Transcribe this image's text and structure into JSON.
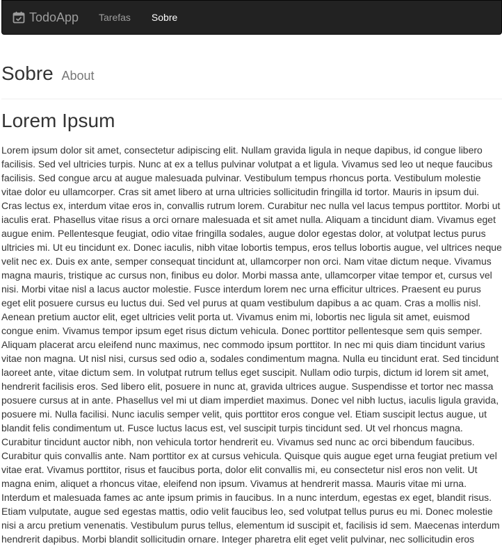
{
  "navbar": {
    "brand": "TodoApp",
    "brand_icon": "calendar-check-icon",
    "items": [
      {
        "label": "Tarefas",
        "active": false
      },
      {
        "label": "Sobre",
        "active": true
      }
    ]
  },
  "header": {
    "title": "Sobre",
    "subtitle": "About"
  },
  "content": {
    "heading": "Lorem Ipsum",
    "paragraph": "Lorem ipsum dolor sit amet, consectetur adipiscing elit. Nullam gravida ligula in neque dapibus, id congue libero facilisis. Sed vel ultricies turpis. Nunc at ex a tellus pulvinar volutpat a et ligula. Vivamus sed leo ut neque faucibus facilisis. Sed congue arcu at augue malesuada pulvinar. Vestibulum tempus rhoncus porta. Vestibulum molestie vitae dolor eu ullamcorper. Cras sit amet libero at urna ultricies sollicitudin fringilla id tortor. Mauris in ipsum dui. Cras lectus ex, interdum vitae eros in, convallis rutrum lorem. Curabitur nec nulla vel lacus tempus porttitor. Morbi ut iaculis erat. Phasellus vitae risus a orci ornare malesuada et sit amet nulla. Aliquam a tincidunt diam. Vivamus eget augue enim. Pellentesque feugiat, odio vitae fringilla sodales, augue dolor egestas dolor, at volutpat lectus purus ultricies mi. Ut eu tincidunt ex. Donec iaculis, nibh vitae lobortis tempus, eros tellus lobortis augue, vel ultrices neque velit nec ex. Duis ex ante, semper consequat tincidunt at, ullamcorper non orci. Nam vitae dictum neque. Vivamus magna mauris, tristique ac cursus non, finibus eu dolor. Morbi massa ante, ullamcorper vitae tempor et, cursus vel nisi. Morbi vitae nisl a lacus auctor molestie. Fusce interdum lorem nec urna efficitur ultrices. Praesent eu purus eget elit posuere cursus eu luctus dui. Sed vel purus at quam vestibulum dapibus a ac quam. Cras a mollis nisl. Aenean pretium auctor elit, eget ultricies velit porta ut. Vivamus enim mi, lobortis nec ligula sit amet, euismod congue enim. Vivamus tempor ipsum eget risus dictum vehicula. Donec porttitor pellentesque sem quis semper. Aliquam placerat arcu eleifend nunc maximus, nec commodo ipsum porttitor. In nec mi quis diam tincidunt varius vitae non magna. Ut nisl nisi, cursus sed odio a, sodales condimentum magna. Nulla eu tincidunt erat. Sed tincidunt laoreet ante, vitae dictum sem. In volutpat rutrum tellus eget suscipit. Nullam odio turpis, dictum id lorem sit amet, hendrerit facilisis eros. Sed libero elit, posuere in nunc at, gravida ultrices augue. Suspendisse et tortor nec massa posuere cursus at in ante. Phasellus vel mi ut diam imperdiet maximus. Donec vel nibh luctus, iaculis ligula gravida, posuere mi. Nulla facilisi. Nunc iaculis semper velit, quis porttitor eros congue vel. Etiam suscipit lectus augue, ut blandit felis condimentum ut. Fusce luctus lacus est, vel suscipit turpis tincidunt sed. Ut vel rhoncus magna. Curabitur tincidunt auctor nibh, non vehicula tortor hendrerit eu. Vivamus sed nunc ac orci bibendum faucibus. Curabitur quis convallis ante. Nam porttitor ex at cursus vehicula. Quisque quis augue eget urna feugiat pretium vel vitae erat. Vivamus porttitor, risus et faucibus porta, dolor elit convallis mi, eu consectetur nisl eros non velit. Ut magna enim, aliquet a rhoncus vitae, eleifend non ipsum. Vivamus at hendrerit massa. Mauris vitae mi urna. Interdum et malesuada fames ac ante ipsum primis in faucibus. In a nunc interdum, egestas ex eget, blandit risus. Etiam vulputate, augue sed egestas mattis, odio velit faucibus leo, sed volutpat tellus purus eu mi. Donec molestie nisi a arcu pretium venenatis. Vestibulum purus tellus, elementum id suscipit et, facilisis id sem. Maecenas interdum hendrerit dapibus. Morbi blandit sollicitudin ornare. Integer pharetra elit eget velit pulvinar, nec sollicitudin eros"
  },
  "colors": {
    "navbar_bg": "#222222",
    "nav_text": "#9d9d9d",
    "nav_active_text": "#ffffff",
    "body_text": "#333333",
    "muted_text": "#777777"
  }
}
